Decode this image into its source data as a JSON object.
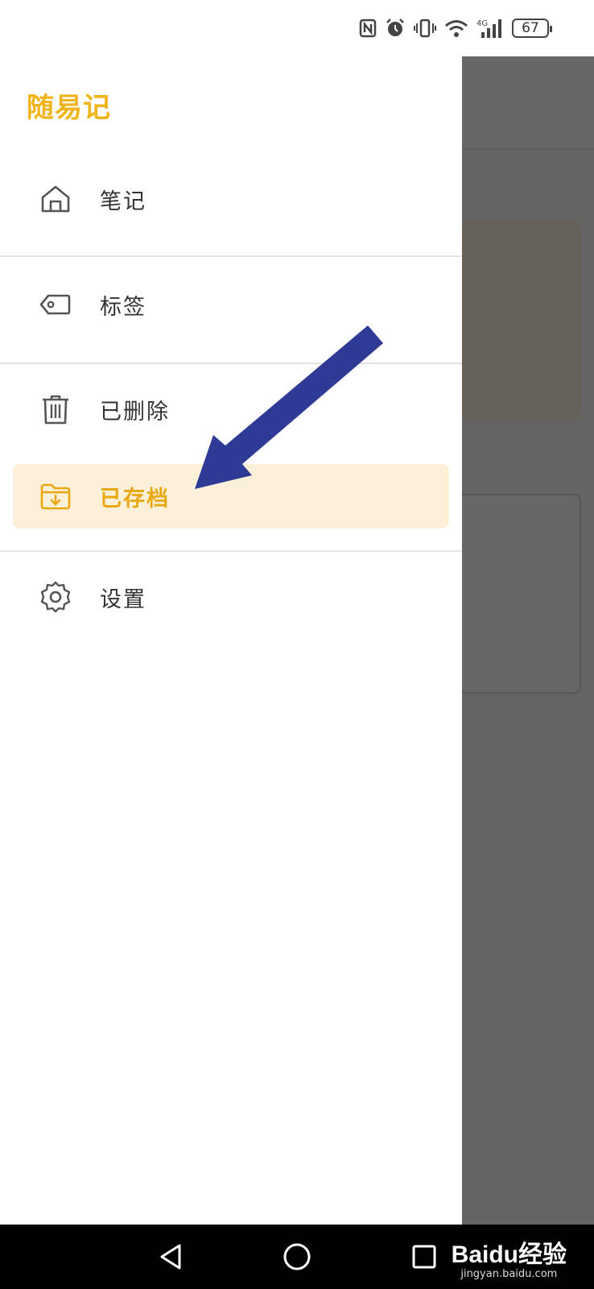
{
  "status_bar": {
    "battery": "67",
    "network": "4G",
    "icons": [
      "nfc-icon",
      "alarm-icon",
      "vibrate-icon",
      "wifi-icon",
      "signal-icon",
      "battery-icon"
    ]
  },
  "drawer": {
    "title": "随易记",
    "items": [
      {
        "label": "笔记",
        "icon": "home-icon"
      },
      {
        "label": "标签",
        "icon": "tag-icon"
      },
      {
        "label": "已删除",
        "icon": "trash-icon"
      },
      {
        "label": "已存档",
        "icon": "archive-folder-icon",
        "active": true
      },
      {
        "label": "设置",
        "icon": "gear-icon"
      }
    ]
  },
  "colors": {
    "accent": "#f0b418",
    "active_bg": "#fdf0d8",
    "annotation_arrow": "#2e3a96"
  },
  "watermark": {
    "logo": "Baidu经验",
    "url": "jingyan.baidu.com"
  }
}
